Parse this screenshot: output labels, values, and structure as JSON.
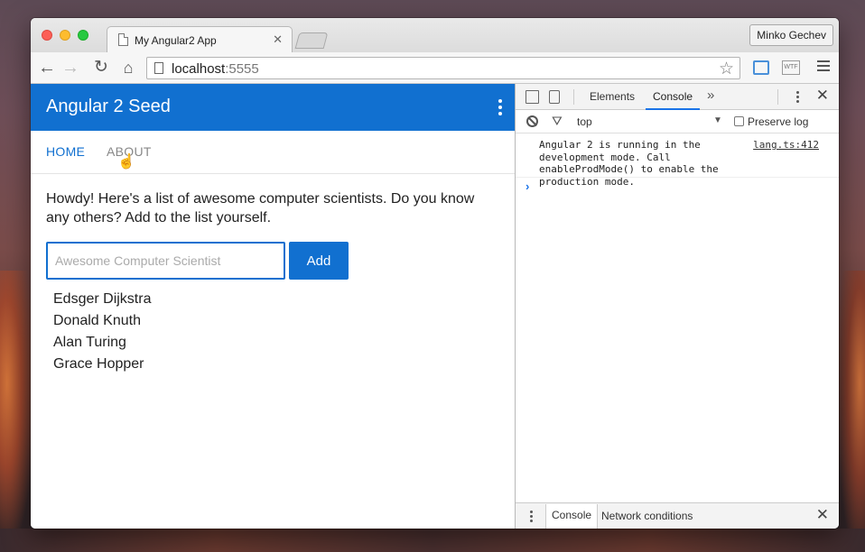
{
  "browser": {
    "tab_title": "My Angular2 App",
    "tab_close": "✕",
    "profile_name": "Minko Gechev",
    "url_host": "localhost",
    "url_port": ":5555",
    "icons": {
      "back": "←",
      "forward": "→",
      "reload": "↻",
      "home": "⌂",
      "star": "☆",
      "wtf": "WTF"
    }
  },
  "app": {
    "title": "Angular 2 Seed",
    "nav": {
      "home": "HOME",
      "about": "ABOUT"
    },
    "intro": "Howdy! Here's a list of awesome computer scientists. Do you know any others? Add to the list yourself.",
    "input_placeholder": "Awesome Computer Scientist",
    "add_label": "Add",
    "scientists": [
      "Edsger Dijkstra",
      "Donald Knuth",
      "Alan Turing",
      "Grace Hopper"
    ],
    "accent_color": "#1170d0"
  },
  "devtools": {
    "tabs": {
      "elements": "Elements",
      "console": "Console",
      "more": "»"
    },
    "close": "✕",
    "filter": {
      "icon": "⛛",
      "context": "top",
      "caret": "▼",
      "preserve_log": "Preserve log"
    },
    "message": {
      "text": "Angular 2 is running in the development mode. Call enableProdMode() to enable the production mode.",
      "source": "lang.ts:412"
    },
    "prompt": "›",
    "drawer": {
      "console": "Console",
      "network": "Network conditions",
      "close": "✕"
    }
  }
}
